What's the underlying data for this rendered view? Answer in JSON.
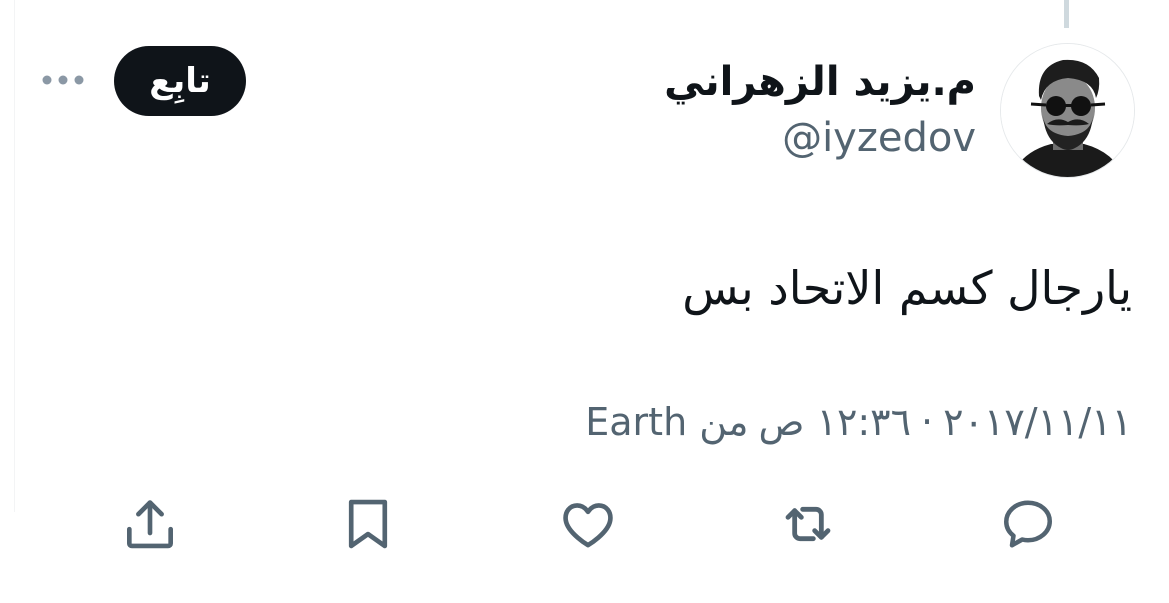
{
  "user": {
    "display_name": "م.يزيد الزهراني",
    "handle": "@iyzedov",
    "avatar": "avatar-photo-man-with-sunglasses-and-beard"
  },
  "follow_button": {
    "label": "تابِع"
  },
  "tweet": {
    "text": "يارجال كسم الاتحاد بس",
    "date": "٢٠١٧/١١/١١",
    "separator": "·",
    "time": "١٢:٣٦ ص",
    "source": "من Earth"
  },
  "actions": {
    "icons": [
      "reply-icon",
      "retweet-icon",
      "like-icon",
      "bookmark-icon",
      "share-icon"
    ]
  },
  "colors": {
    "text_primary": "#0f1419",
    "text_secondary": "#536471",
    "button_bg": "#0f1419",
    "button_text": "#ffffff",
    "icon": "#536471"
  }
}
